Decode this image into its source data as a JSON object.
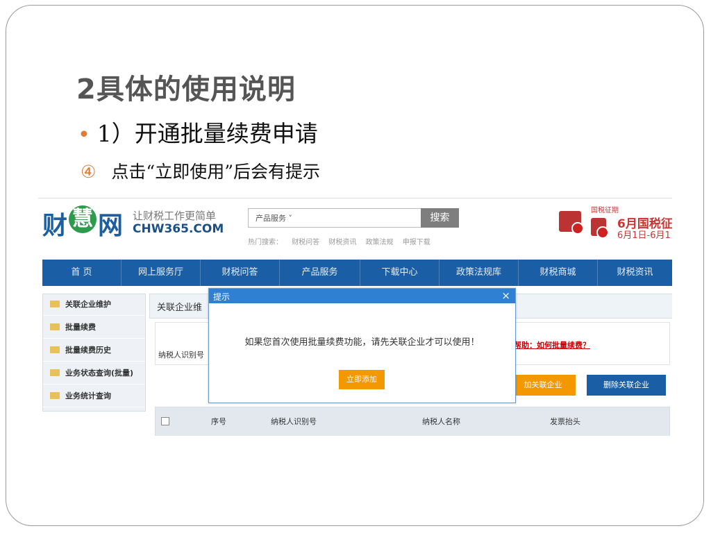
{
  "slide": {
    "title": "2具体的使用说明",
    "bullet_marker": "•",
    "bullet": "1）开通批量续费申请",
    "sub_marker": "④",
    "sub": "点击“立即使用”后会有提示"
  },
  "site": {
    "logo_left": "财",
    "logo_mid": "慧",
    "logo_right": "网",
    "slogan": "让财税工作更简单",
    "domain": "CHW365.COM",
    "search": {
      "category": "产品服务 ˅",
      "button": "搜索"
    },
    "hot": {
      "label": "热门搜索：",
      "items": [
        "财税问答",
        "财税资讯",
        "政策法规",
        "申报下载"
      ]
    },
    "promo": {
      "top": "国税征期",
      "line1": "6月国税征",
      "line2": "6月1日-6月1"
    },
    "nav": [
      "首 页",
      "网上服务厅",
      "财税问答",
      "产品服务",
      "下载中心",
      "政策法规库",
      "财税商城",
      "财税资讯"
    ],
    "sidebar": [
      "关联企业维护",
      "批量续费",
      "批量续费历史",
      "业务状态查询(批量)",
      "业务统计查询"
    ],
    "content_title": "关联企业维",
    "query_label": "纳税人识别号",
    "help_link": "帮助：如何批量续费？",
    "btn_add": "加关联企业",
    "btn_del": "删除关联企业",
    "table_headers": [
      "序号",
      "纳税人识别号",
      "纳税人名称",
      "发票抬头"
    ]
  },
  "dialog": {
    "title": "提示",
    "close": "×",
    "message": "如果您首次使用批量续费功能，请先关联企业才可以使用！",
    "button": "立即添加"
  },
  "colors": {
    "nav": "#1a5fa5",
    "accent": "#f39800",
    "dialog_head": "#2f7fd3"
  }
}
